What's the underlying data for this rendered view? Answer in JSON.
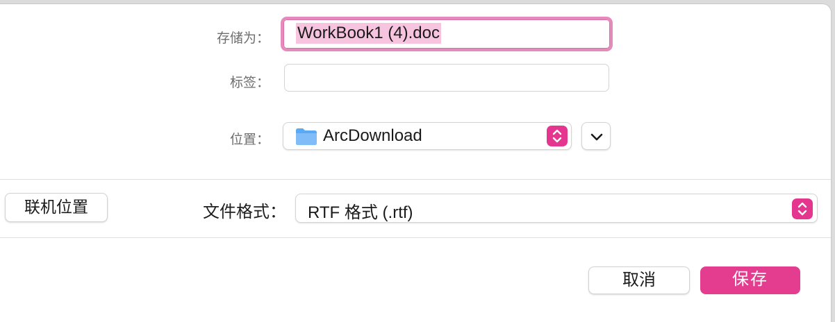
{
  "dialog": {
    "save_as_label": "存储为：",
    "save_as_value": "WorkBook1 (4).doc",
    "tags_label": "标签：",
    "tags_value": "",
    "location_label": "位置：",
    "location_value": "ArcDownload",
    "online_locations_label": "联机位置",
    "format_label": "文件格式：",
    "format_value": "RTF 格式 (.rtf)",
    "cancel_label": "取消",
    "save_label": "保存"
  },
  "colors": {
    "accent": "#e43d8f",
    "focus_ring": "#e48bbb",
    "selection": "#f6c4df",
    "folder": "#5aa9f5"
  },
  "icons": {
    "folder": "folder-icon",
    "location_stepper": "up-down-chevron-icon",
    "expand": "chevron-down-icon",
    "format_stepper": "up-down-chevron-icon"
  }
}
